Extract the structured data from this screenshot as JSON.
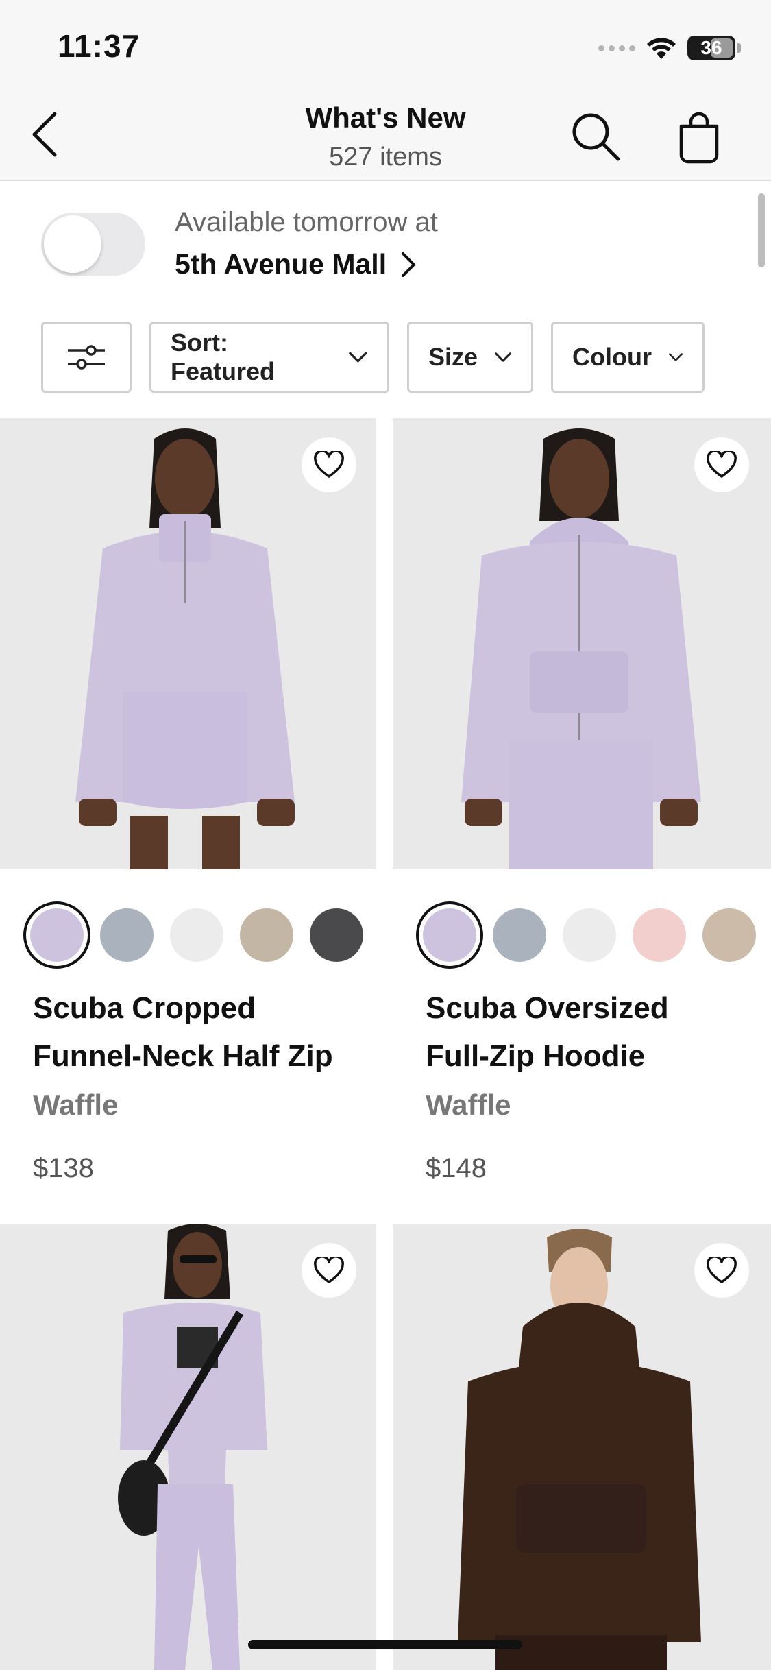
{
  "status_bar": {
    "time": "11:37",
    "battery": "36",
    "icons": [
      "signal-dots-icon",
      "wifi-icon",
      "battery-icon"
    ]
  },
  "header": {
    "title": "What's New",
    "subtitle": "527 items",
    "icons": [
      "back-chevron-icon",
      "search-icon",
      "shopping-bag-icon"
    ]
  },
  "store": {
    "toggle_on": false,
    "availability_text": "Available tomorrow at",
    "store_name": "5th Avenue Mall"
  },
  "filters": {
    "sort_label": "Sort: Featured",
    "size_label": "Size",
    "colour_label": "Colour",
    "icons": [
      "filter-sliders-icon",
      "chevron-down-icon"
    ]
  },
  "products": [
    {
      "name_line1": "Scuba Cropped",
      "name_line2": "Funnel-Neck Half Zip",
      "material": "Waffle",
      "price": "$138",
      "swatches": [
        "#cdc3df",
        "#a9b2bd",
        "#ececec",
        "#c4b6a4",
        "#4a4a4c"
      ],
      "selected_swatch": 0
    },
    {
      "name_line1": "Scuba Oversized",
      "name_line2": "Full-Zip Hoodie",
      "material": "Waffle",
      "price": "$148",
      "swatches": [
        "#cdc3df",
        "#a9b2bd",
        "#ececec",
        "#f2cfcd",
        "#cbbba8"
      ],
      "selected_swatch": 0
    },
    {
      "name_line1": "",
      "name_line2": "",
      "material": "",
      "price": "",
      "swatches": [],
      "selected_swatch": -1
    },
    {
      "name_line1": "",
      "name_line2": "",
      "material": "",
      "price": "",
      "swatches": [],
      "selected_swatch": -1
    }
  ],
  "colors": {
    "lilac": "#c9bde0",
    "brown": "#3b2418",
    "photo_bg": "#e9e9e9"
  }
}
